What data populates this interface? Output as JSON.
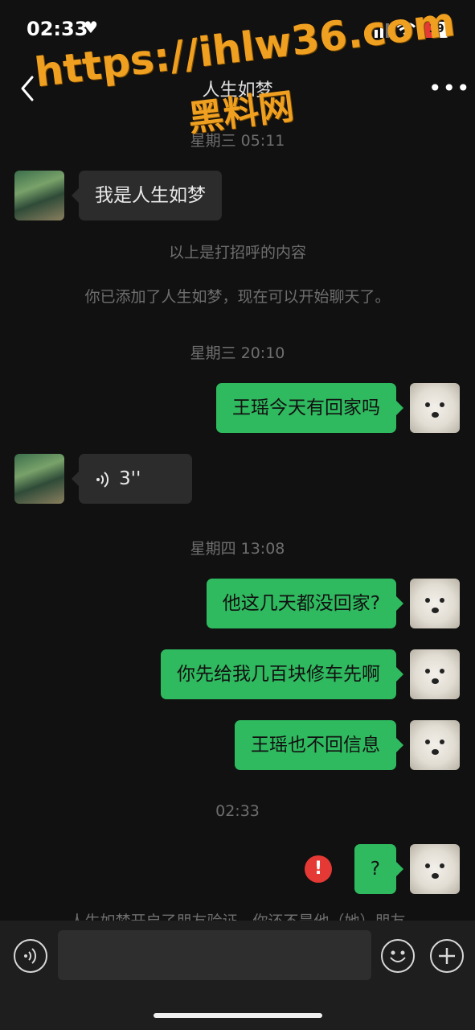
{
  "status_bar": {
    "time": "02:33",
    "battery": "19"
  },
  "header": {
    "title": "人生如梦"
  },
  "watermark": {
    "line1": "https://ihlw36.com",
    "line2": "黑料网"
  },
  "messages": {
    "stamp1": "星期三 05:11",
    "greeting": "我是人生如梦",
    "sys1": "以上是打招呼的内容",
    "sys2": "你已添加了人生如梦，现在可以开始聊天了。",
    "stamp2": "星期三 20:10",
    "out1": "王瑶今天有回家吗",
    "voice_duration": "3''",
    "stamp3": "星期四 13:08",
    "out2": "他这几天都没回家?",
    "out3": "你先给我几百块修车先啊",
    "out4": "王瑶也不回信息",
    "stamp4": "02:33",
    "out5": "?",
    "error_mark": "!",
    "notice": "人生如梦开启了朋友验证，你还不是他（她）朋友"
  },
  "input_bar": {
    "text_value": ""
  }
}
